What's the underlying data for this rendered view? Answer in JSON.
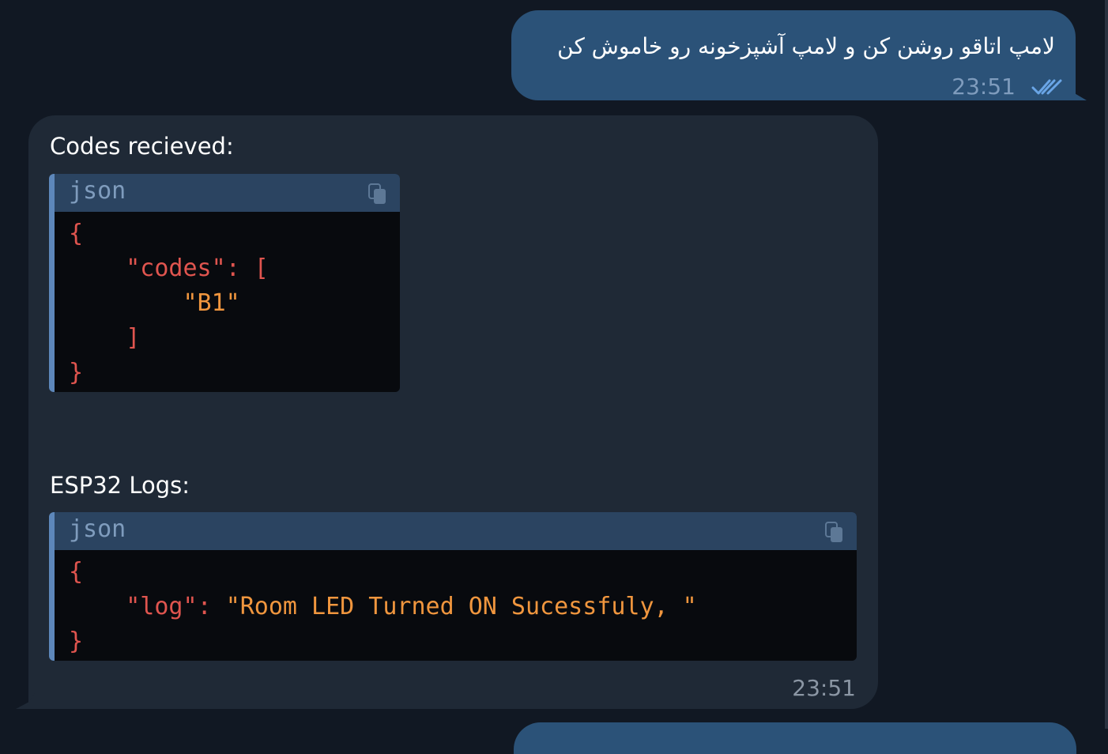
{
  "outgoing": {
    "text": "لامپ اتاقو روشن کن و لامپ آشپزخونه رو خاموش کن",
    "time": "23:51",
    "status": "double-check-icon"
  },
  "incoming": {
    "codes_label": "Codes recieved:",
    "codes_block": {
      "lang": "json",
      "lines": [
        [
          {
            "t": "{",
            "c": "punct"
          }
        ],
        [
          {
            "t": "    "
          },
          {
            "t": "\"codes\"",
            "c": "key"
          },
          {
            "t": ": [",
            "c": "punct"
          }
        ],
        [
          {
            "t": "        "
          },
          {
            "t": "\"B1\"",
            "c": "str"
          }
        ],
        [
          {
            "t": "    "
          },
          {
            "t": "]",
            "c": "punct"
          }
        ],
        [
          {
            "t": "}",
            "c": "punct"
          }
        ]
      ]
    },
    "logs_label": "ESP32 Logs:",
    "logs_block": {
      "lang": "json",
      "lines": [
        [
          {
            "t": "{",
            "c": "punct"
          }
        ],
        [
          {
            "t": "    "
          },
          {
            "t": "\"log\"",
            "c": "key"
          },
          {
            "t": ": ",
            "c": "punct"
          },
          {
            "t": "\"Room LED Turned ON Sucessfuly, \"",
            "c": "str"
          }
        ],
        [
          {
            "t": "}",
            "c": "punct"
          }
        ]
      ]
    },
    "time": "23:51"
  },
  "colors": {
    "background": "#111823",
    "outgoing_bubble": "#2b5278",
    "incoming_bubble": "#1f2936",
    "code_accent": "#5d87ba",
    "code_punct": "#e0554f",
    "code_string": "#f0963e"
  }
}
